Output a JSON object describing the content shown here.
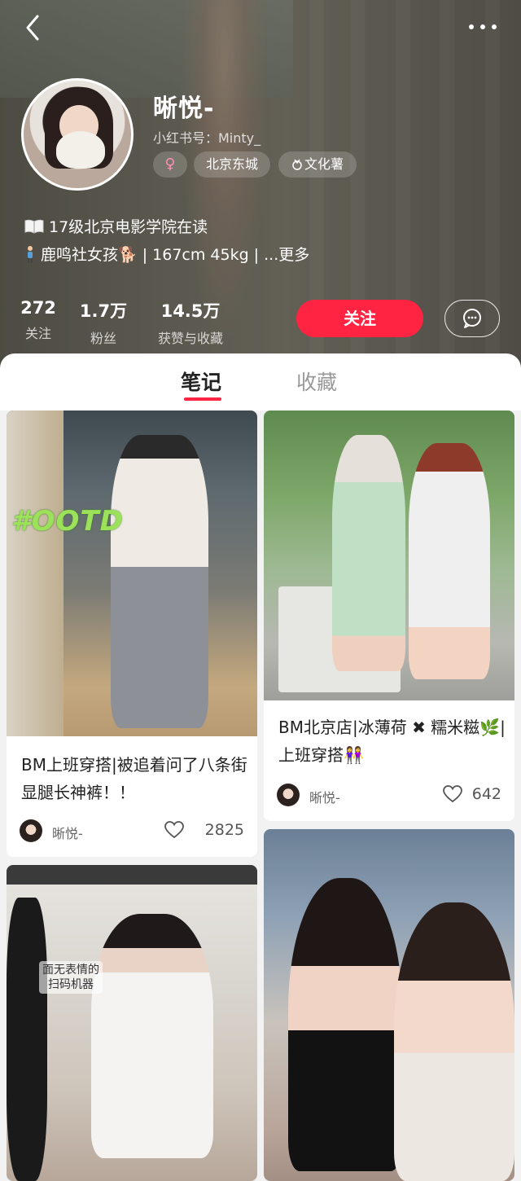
{
  "profile": {
    "name": "晰悦-",
    "red_id": "小红书号：Minty_",
    "gender_symbol": "♀",
    "location": "北京东城",
    "tag_work": "文化薯",
    "bio_line1": "17级北京电影学院在读",
    "bio_line2": "鹿鸣社女孩🐕 | 167cm 45kg  | ...更多"
  },
  "stats": [
    {
      "value": "272",
      "label": "关注"
    },
    {
      "value": "1.7万",
      "label": "粉丝"
    },
    {
      "value": "14.5万",
      "label": "获赞与收藏"
    }
  ],
  "actions": {
    "follow_label": "关注"
  },
  "tabs": [
    {
      "label": "笔记",
      "active": true
    },
    {
      "label": "收藏",
      "active": false
    }
  ],
  "notes": [
    {
      "title": "BM上班穿搭|被追着问了八条街 显腿长神裤！！",
      "overlay_text": "#OOTD",
      "author": "晰悦-",
      "likes": "2825"
    },
    {
      "title": "BM北京店|冰薄荷 ✖ 糯米糍🌿|上班穿搭👭",
      "author": "晰悦-",
      "likes": "642"
    },
    {
      "overlay_text": "面无表情的\n扫码机器"
    },
    {}
  ],
  "colors": {
    "accent": "#ff2442",
    "text": "#222222",
    "muted": "#999999"
  }
}
